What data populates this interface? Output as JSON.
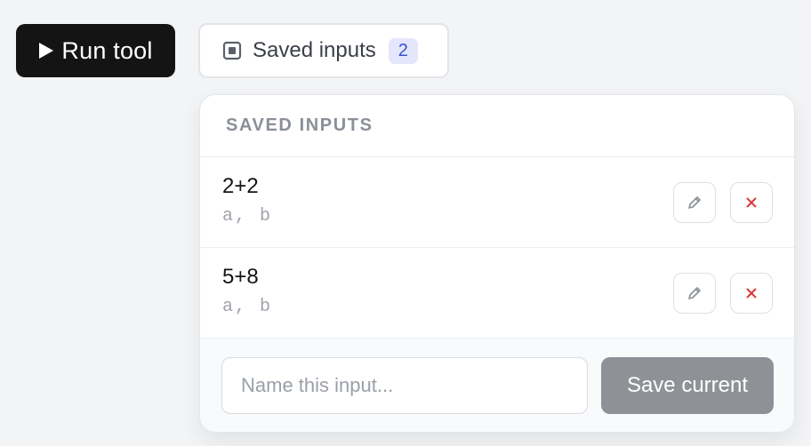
{
  "toolbar": {
    "run_label": "Run tool",
    "saved_label": "Saved inputs",
    "saved_count": "2"
  },
  "panel": {
    "title": "SAVED INPUTS",
    "items": [
      {
        "name": "2+2",
        "args": "a, b"
      },
      {
        "name": "5+8",
        "args": "a, b"
      }
    ],
    "name_placeholder": "Name this input...",
    "name_value": "",
    "save_label": "Save current"
  },
  "icons": {
    "run": "play-icon",
    "saved": "stack-icon",
    "edit": "pencil-icon",
    "delete": "close-icon"
  },
  "colors": {
    "run_button_bg": "#141414",
    "badge_bg": "#e4e7fb",
    "badge_text": "#3b4fd1",
    "delete_icon": "#d93a3a",
    "save_button_bg": "#8e9196"
  }
}
